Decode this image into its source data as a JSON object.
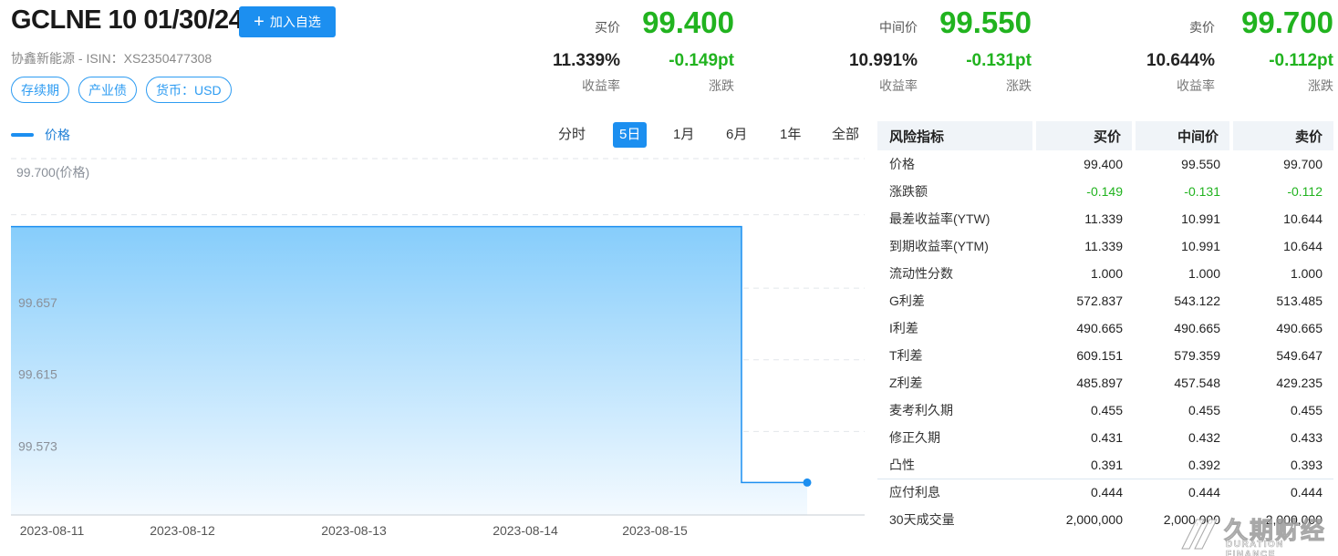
{
  "header": {
    "title": "GCLNE 10 01/30/24",
    "add_button_label": "加入自选",
    "subtitle": "协鑫新能源 - ISIN：XS2350477308",
    "tags": [
      "存续期",
      "产业债",
      "货币：USD"
    ]
  },
  "quotes": [
    {
      "label": "买价",
      "price": "99.400",
      "yield": "11.339%",
      "change": "-0.149pt",
      "yield_label": "收益率",
      "change_label": "涨跌"
    },
    {
      "label": "中间价",
      "price": "99.550",
      "yield": "10.991%",
      "change": "-0.131pt",
      "yield_label": "收益率",
      "change_label": "涨跌"
    },
    {
      "label": "卖价",
      "price": "99.700",
      "yield": "10.644%",
      "change": "-0.112pt",
      "yield_label": "收益率",
      "change_label": "涨跌"
    }
  ],
  "chart": {
    "legend": "价格",
    "ranges": [
      "分时",
      "5日",
      "1月",
      "6月",
      "1年",
      "全部"
    ],
    "active_range": "5日"
  },
  "chart_data": {
    "type": "area",
    "series": [
      {
        "name": "价格",
        "values": [
          99.7,
          99.7,
          99.7,
          99.7,
          99.55,
          99.55
        ]
      }
    ],
    "x": [
      "2023-08-11",
      "2023-08-12",
      "2023-08-13",
      "2023-08-14",
      "2023-08-15",
      "2023-08-15"
    ],
    "x_ticks": [
      "2023-08-11",
      "2023-08-12",
      "2023-08-13",
      "2023-08-14",
      "2023-08-15"
    ],
    "y_ticks": [
      "99.700(价格)",
      "99.657",
      "99.615",
      "99.573"
    ],
    "ylim": [
      99.531,
      99.742
    ],
    "grid": true,
    "colors": {
      "line": "#1c8ff0",
      "fill_top": "#86cdfb",
      "fill_bottom": "#f4faff",
      "marker": "#1c8ff0"
    }
  },
  "risk_table": {
    "headers": [
      "风险指标",
      "买价",
      "中间价",
      "卖价"
    ],
    "rows": [
      {
        "name": "价格",
        "bid": "99.400",
        "mid": "99.550",
        "ask": "99.700"
      },
      {
        "name": "涨跌额",
        "bid": "-0.149",
        "mid": "-0.131",
        "ask": "-0.112",
        "green": true
      },
      {
        "name": "最差收益率(YTW)",
        "bid": "11.339",
        "mid": "10.991",
        "ask": "10.644"
      },
      {
        "name": "到期收益率(YTM)",
        "bid": "11.339",
        "mid": "10.991",
        "ask": "10.644"
      },
      {
        "name": "流动性分数",
        "bid": "1.000",
        "mid": "1.000",
        "ask": "1.000"
      },
      {
        "name": "G利差",
        "bid": "572.837",
        "mid": "543.122",
        "ask": "513.485"
      },
      {
        "name": "I利差",
        "bid": "490.665",
        "mid": "490.665",
        "ask": "490.665"
      },
      {
        "name": "T利差",
        "bid": "609.151",
        "mid": "579.359",
        "ask": "549.647"
      },
      {
        "name": "Z利差",
        "bid": "485.897",
        "mid": "457.548",
        "ask": "429.235"
      },
      {
        "name": "麦考利久期",
        "bid": "0.455",
        "mid": "0.455",
        "ask": "0.455"
      },
      {
        "name": "修正久期",
        "bid": "0.431",
        "mid": "0.432",
        "ask": "0.433"
      },
      {
        "name": "凸性",
        "bid": "0.391",
        "mid": "0.392",
        "ask": "0.393"
      },
      {
        "name": "应付利息",
        "bid": "0.444",
        "mid": "0.444",
        "ask": "0.444",
        "sep": true
      },
      {
        "name": "30天成交量",
        "bid": "2,000,000",
        "mid": "2,000,000",
        "ask": "2,000,000"
      }
    ]
  },
  "watermark": {
    "cn": "久期财经",
    "en": "DURATION FINANCE"
  }
}
